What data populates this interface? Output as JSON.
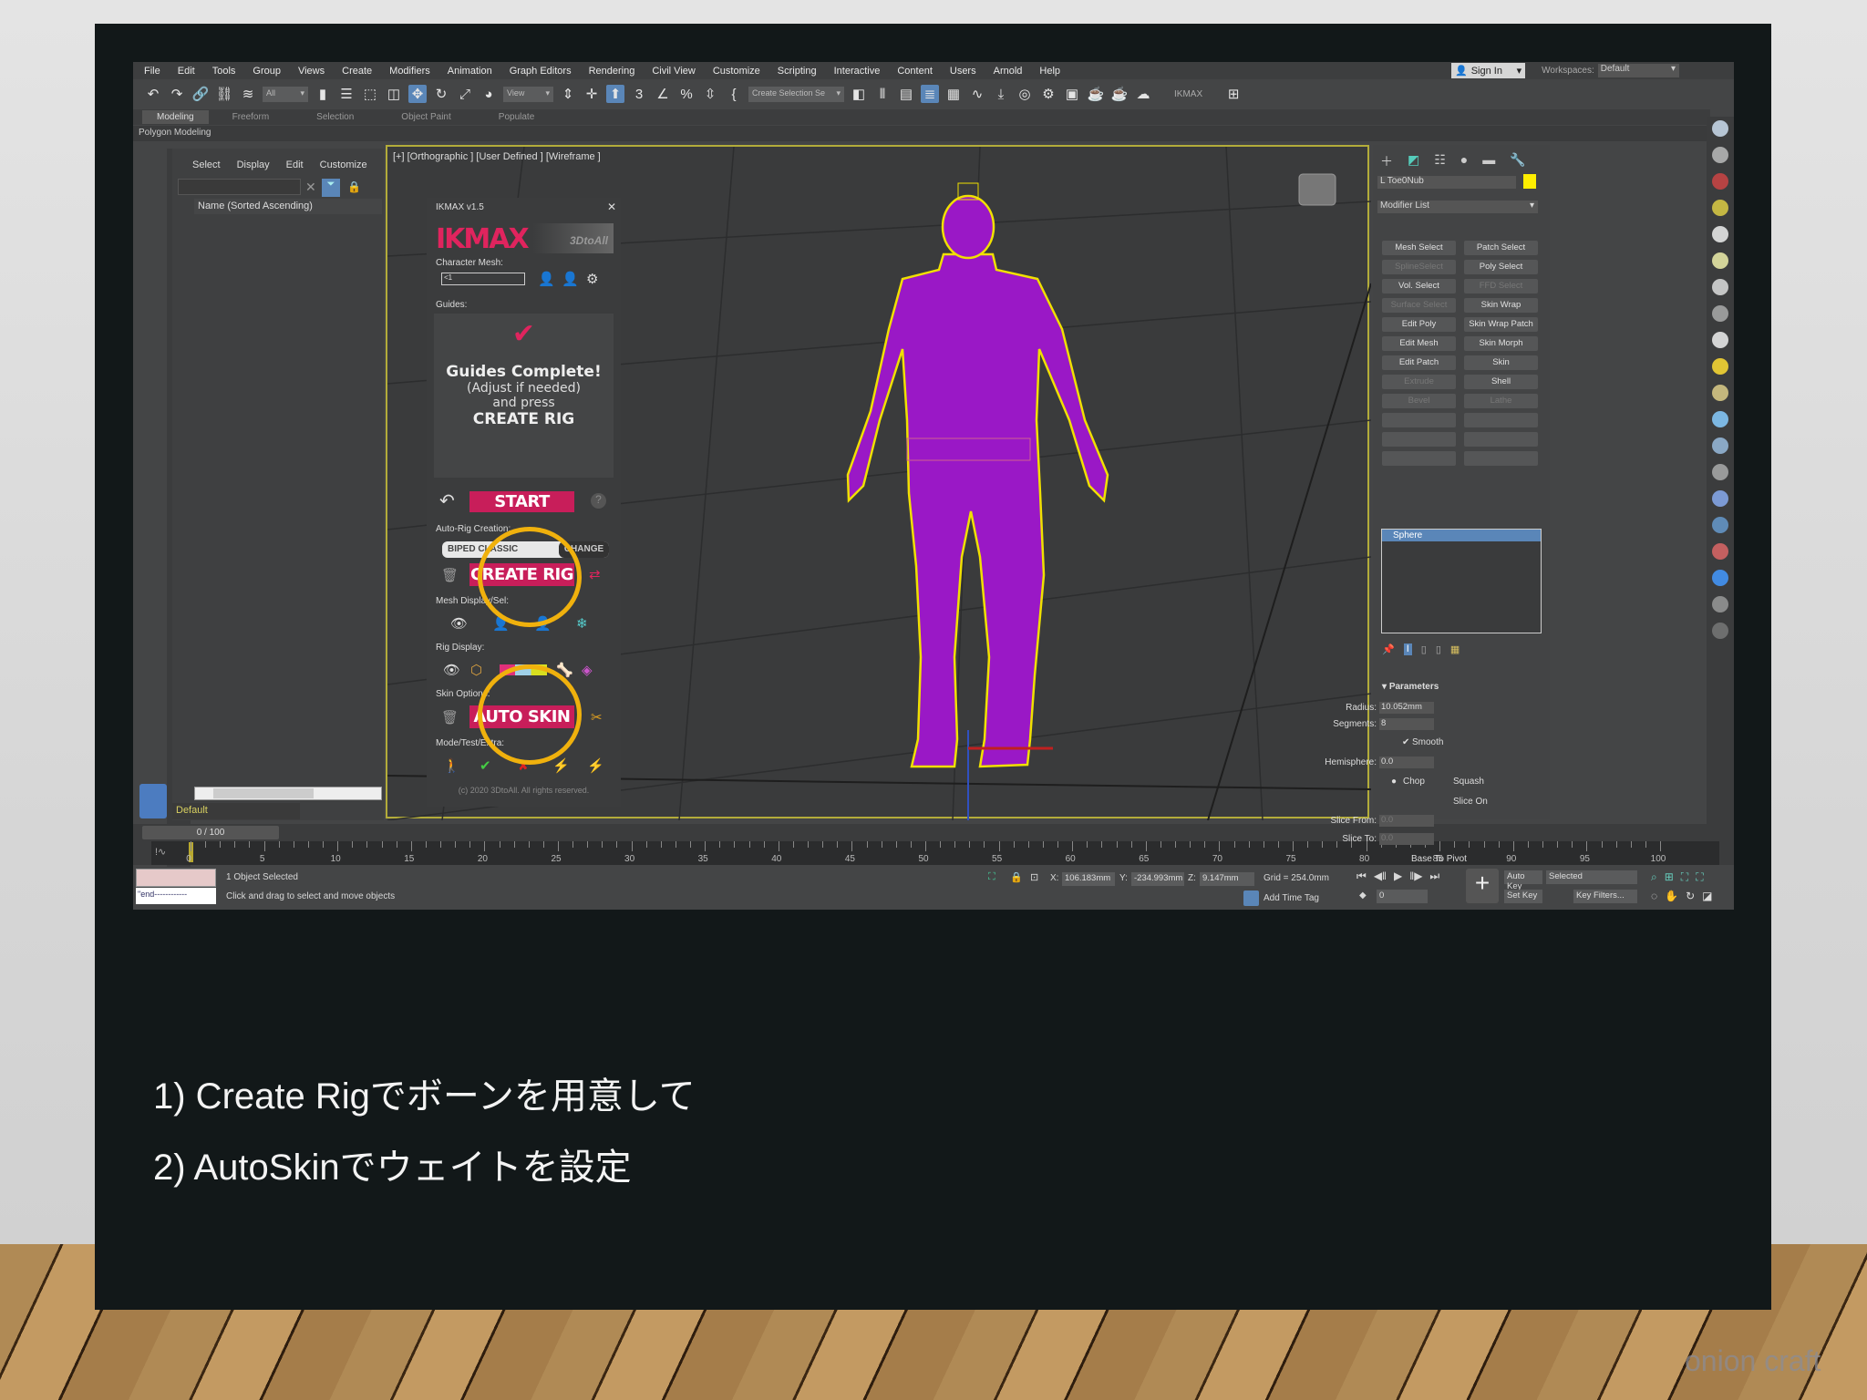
{
  "menu": [
    "File",
    "Edit",
    "Tools",
    "Group",
    "Views",
    "Create",
    "Modifiers",
    "Animation",
    "Graph Editors",
    "Rendering",
    "Civil View",
    "Customize",
    "Scripting",
    "Interactive",
    "Content",
    "Users",
    "Arnold",
    "Help"
  ],
  "account": {
    "sign_in": "Sign In",
    "workspaces_label": "Workspaces:",
    "workspace": "Default"
  },
  "toolbar": {
    "selection_filter": "All",
    "ref_coord": "View",
    "selection_set": "Create Selection Se",
    "ikmax_label": "IKMAX",
    "icons": [
      "undo-icon",
      "redo-icon",
      "link-icon",
      "unlink-icon",
      "bind-space-warp-icon"
    ],
    "icons2": [
      "select-object-icon",
      "select-by-name-icon",
      "rect-selection-icon",
      "window-crossing-icon",
      "move-icon",
      "rotate-icon",
      "scale-icon",
      "placement-icon"
    ],
    "icons3": [
      "use-pivot-icon",
      "manipulate-icon",
      "keyboard-shortcut-icon",
      "snap-3d-icon",
      "angle-snap-icon",
      "percent-snap-icon",
      "spinner-snap-icon",
      "edit-named-sets-icon"
    ],
    "icons4": [
      "mirror-icon",
      "align-icon",
      "layer-explorer-icon",
      "scene-explorer-icon",
      "schematic-view-icon",
      "curve-editor-icon",
      "dope-sheet-icon",
      "material-editor-icon",
      "render-setup-icon",
      "rendered-frame-icon",
      "render-icon",
      "render-production-icon",
      "render-cloud-icon"
    ]
  },
  "ribbon": {
    "tabs": [
      "Modeling",
      "Freeform",
      "Selection",
      "Object Paint",
      "Populate"
    ],
    "sub": "Polygon Modeling"
  },
  "explorer": {
    "menu": [
      "Select",
      "Display",
      "Edit",
      "Customize"
    ],
    "column": "Name (Sorted Ascending)",
    "layer": "Default",
    "frame": "0 / 100"
  },
  "viewport": {
    "label": "[+] [Orthographic ] [User Defined ] [Wireframe ]"
  },
  "ikmax": {
    "title": "IKMAX v1.5",
    "logo": "IKMAX",
    "logo_sub": "3DtoAll",
    "character_mesh_label": "Character Mesh:",
    "character_mesh_value": "<1",
    "guides_label": "Guides:",
    "guides_line1": "Guides Complete!",
    "guides_line2": "(Adjust if needed)",
    "guides_line3": "and press",
    "guides_line4": "CREATE RIG",
    "start": "START",
    "auto_rig_label": "Auto-Rig Creation:",
    "rig_type": "BIPED CLASSIC",
    "change": "CHANGE",
    "create_rig": "CREATE RIG",
    "mesh_display_label": "Mesh Display/Sel:",
    "rig_display_label": "Rig Display:",
    "skin_options_label": "Skin Options:",
    "auto_skin": "AUTO SKIN",
    "mode_label": "Mode/Test/Extra:",
    "copyright": "(c) 2020 3DtoAll. All rights reserved.",
    "highlight_color": "#f0b10d",
    "accent": "#c81e5a"
  },
  "command": {
    "object_name": "L Toe0Nub",
    "object_color": "#ffee00",
    "modifier_list": "Modifier List",
    "buttons": [
      {
        "label": "Mesh Select",
        "enabled": true
      },
      {
        "label": "Patch Select",
        "enabled": true
      },
      {
        "label": "SplineSelect",
        "enabled": false
      },
      {
        "label": "Poly Select",
        "enabled": true
      },
      {
        "label": "Vol. Select",
        "enabled": true
      },
      {
        "label": "FFD Select",
        "enabled": false
      },
      {
        "label": "Surface Select",
        "enabled": false
      },
      {
        "label": "Skin Wrap",
        "enabled": true
      },
      {
        "label": "Edit Poly",
        "enabled": true
      },
      {
        "label": "Skin Wrap Patch",
        "enabled": true
      },
      {
        "label": "Edit Mesh",
        "enabled": true
      },
      {
        "label": "Skin Morph",
        "enabled": true
      },
      {
        "label": "Edit Patch",
        "enabled": true
      },
      {
        "label": "Skin",
        "enabled": true
      },
      {
        "label": "Extrude",
        "enabled": false
      },
      {
        "label": "Shell",
        "enabled": true
      },
      {
        "label": "Bevel",
        "enabled": false
      },
      {
        "label": "Lathe",
        "enabled": false
      },
      {
        "label": "",
        "enabled": false
      },
      {
        "label": "",
        "enabled": false
      },
      {
        "label": "",
        "enabled": false
      },
      {
        "label": "",
        "enabled": false
      },
      {
        "label": "",
        "enabled": false
      },
      {
        "label": "",
        "enabled": false
      }
    ],
    "stack": [
      "Sphere"
    ],
    "params": {
      "title": "Parameters",
      "radius_label": "Radius:",
      "radius": "10.052mm",
      "segments_label": "Segments:",
      "segments": "8",
      "smooth": "Smooth",
      "hemisphere_label": "Hemisphere:",
      "hemisphere": "0.0",
      "chop": "Chop",
      "squash": "Squash",
      "slice_on": "Slice On",
      "slice_from_label": "Slice From:",
      "slice_from": "0.0",
      "slice_to_label": "Slice To:",
      "slice_to": "0.0",
      "base_to_pivot": "Base To Pivot"
    }
  },
  "timeline": {
    "ticks": [
      0,
      5,
      10,
      15,
      20,
      25,
      30,
      35,
      40,
      45,
      50,
      55,
      60,
      65,
      70,
      75,
      80,
      85,
      90,
      95,
      100
    ],
    "current_frame": 0
  },
  "status": {
    "selected": "1 Object Selected",
    "prompt": "Click and drag to select and move objects",
    "maxscript": "\"end------------",
    "x_label": "X:",
    "x": "106.183mm",
    "y_label": "Y:",
    "y": "-234.993mm",
    "z_label": "Z:",
    "z": "9.147mm",
    "grid": "Grid = 254.0mm",
    "add_time_tag": "Add Time Tag",
    "frame": "0",
    "auto_key": "Auto Key",
    "set_key": "Set Key",
    "key_mode": "Selected",
    "key_filters": "Key Filters..."
  },
  "slide": {
    "line1": "1) Create Rigでボーンを用意して",
    "line2": "2) AutoSkinでウェイトを設定",
    "watermark": "onion craft"
  }
}
